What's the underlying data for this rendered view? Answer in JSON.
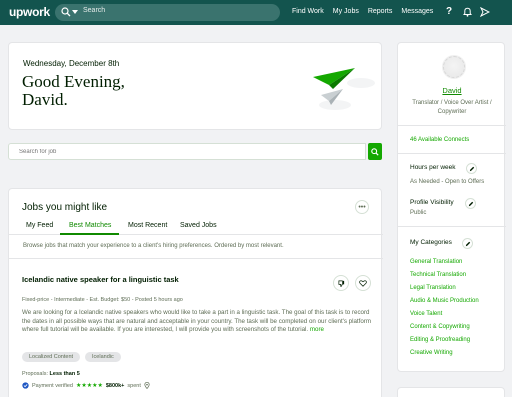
{
  "nav": {
    "logo": "upwork",
    "search_placeholder": "Search",
    "links": [
      "Find Work",
      "My Jobs",
      "Reports",
      "Messages"
    ],
    "icons": [
      "help-icon",
      "notifications-icon",
      "send-icon"
    ]
  },
  "greeting": {
    "date": "Wednesday, December 8th",
    "line1": "Good Evening,",
    "line2": "David."
  },
  "job_search": {
    "placeholder": "Search for job"
  },
  "jobs": {
    "title": "Jobs you might like",
    "tabs": [
      "My Feed",
      "Best Matches",
      "Most Recent",
      "Saved Jobs"
    ],
    "active_tab": "Best Matches",
    "browse_text": "Browse jobs that match your experience to a client's hiring preferences. Ordered by most relevant.",
    "job": {
      "title": "Icelandic native speaker for a linguistic task",
      "meta": "Fixed-price - Intermediate - Est. Budget: $50 - Posted 5 hours ago",
      "description": "We are looking for a Icelandic native speakers who would like to take a part in a linguistic task. The goal of this task is to record the dates in all possible ways that are natural and acceptable in your country. The task will be completed on our client's platform where full tutorial will be available. If you are interested, I will provide you with screenshots of the tutorial.",
      "more_label": "more",
      "skills": [
        "Localized Content",
        "Icelandic"
      ],
      "proposals_label": "Proposals:",
      "proposals_value": "Less than 5",
      "payment_label": "Payment verified",
      "stars": "★★★★★",
      "spent_value": "$800k+",
      "spent_label": "spent"
    }
  },
  "profile": {
    "name": "David",
    "title": "Translator / Voice Over Artist / Copywriter",
    "connects": "46 Available Connects",
    "hours_label": "Hours per week",
    "hours_value": "As Needed - Open to Offers",
    "visibility_label": "Profile Visibility",
    "visibility_value": "Public",
    "categories_label": "My Categories",
    "categories": [
      "General Translation",
      "Technical Translation",
      "Legal Translation",
      "Audio & Music Production",
      "Voice Talent",
      "Content & Copywriting",
      "Editing & Proofreading",
      "Creative Writing"
    ]
  },
  "colors": {
    "nav_bg": "#13544e",
    "accent_green": "#14a800",
    "text_dark": "#001e00",
    "text_muted": "#5e6d55"
  }
}
